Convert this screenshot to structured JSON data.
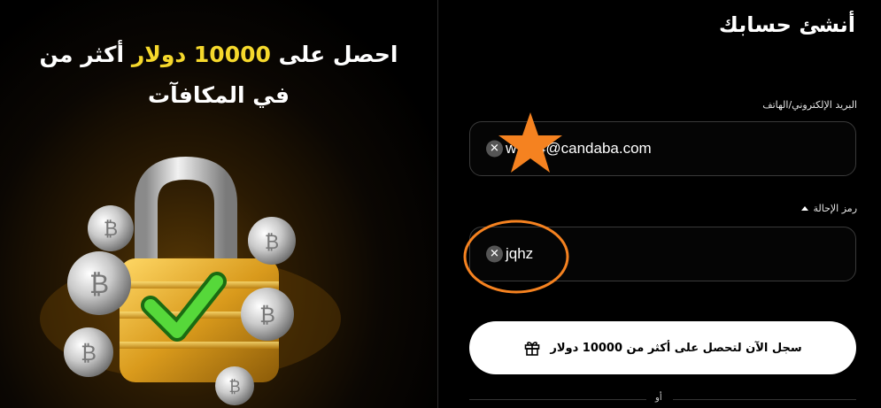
{
  "promo": {
    "line1_part1": "أكثر من",
    "line1_highlight": "10000 دولار",
    "line1_part2": "احصل على",
    "line2": "في المكافآت"
  },
  "form": {
    "title": "أنشئ حسابك",
    "email_label": "البريد الإلكتروني/الهاتف",
    "email_value": "w    424@candaba.com",
    "referral_label": "رمز الإحالة",
    "referral_value": "jqhz",
    "submit_label": "سجل الآن لتحصل على أكثر من 10000 دولار",
    "or_label": "أو"
  },
  "colors": {
    "highlight": "#f5d82c",
    "annotation": "#f58220",
    "button_bg": "#ffffff"
  },
  "icons": {
    "clear": "close-icon",
    "referral_toggle": "caret-up-icon",
    "gift": "gift-icon"
  }
}
